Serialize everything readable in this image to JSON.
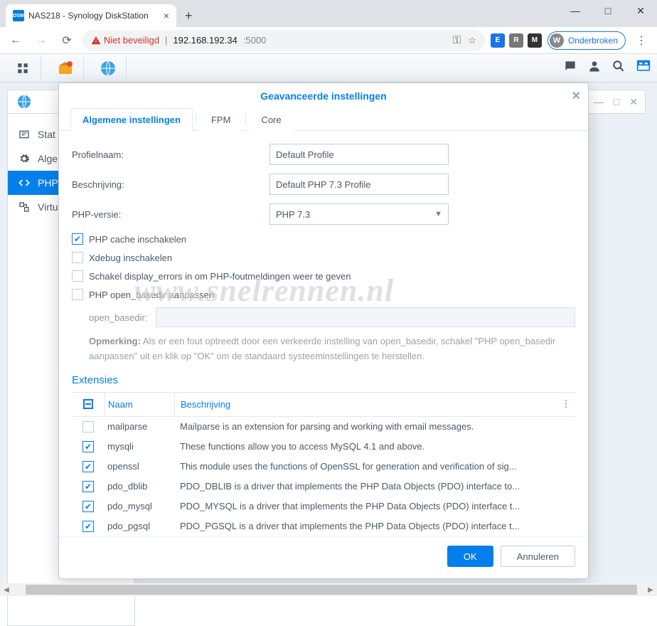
{
  "browser": {
    "tab_title": "NAS218 - Synology DiskStation",
    "tab_favicon_text": "DSM",
    "not_secure": "Niet beveiligd",
    "host": "192.168.192.34",
    "port": ":5000",
    "profile_letter": "W",
    "profile_label": "Onderbroken",
    "ext_badges": [
      "E",
      "R",
      "M"
    ]
  },
  "sidebar": {
    "items": [
      {
        "label": "Stat"
      },
      {
        "label": "Alge"
      },
      {
        "label": "PHP"
      },
      {
        "label": "Virtu"
      }
    ]
  },
  "bg_window": {
    "restore_icon": "—",
    "close_icon": "✕",
    "max_icon": "□"
  },
  "modal": {
    "title": "Geavanceerde instellingen",
    "tabs": {
      "general": "Algemene instellingen",
      "fpm": "FPM",
      "core": "Core"
    },
    "form": {
      "profile_label": "Profielnaam:",
      "profile_value": "Default Profile",
      "desc_label": "Beschrijving:",
      "desc_value": "Default PHP 7.3 Profile",
      "phpver_label": "PHP-versie:",
      "phpver_value": "PHP 7.3",
      "check_cache": "PHP cache inschakelen",
      "check_xdebug": "Xdebug inschakelen",
      "check_display_errors": "Schakel display_errors in om PHP-foutmeldingen weer te geven",
      "check_open_basedir": "PHP open_basedir aanpassen",
      "open_basedir_label": "open_basedir:",
      "note_label": "Opmerking:",
      "note_text": "Als er een fout optreedt door een verkeerde instelling van open_basedir, schakel \"PHP open_basedir aanpassen\" uit en klik op \"OK\" om de standaard systeeminstellingen te herstellen."
    },
    "extensions": {
      "heading": "Extensies",
      "col_name": "Naam",
      "col_desc": "Beschrijving",
      "rows": [
        {
          "checked": false,
          "name": "mailparse",
          "desc": "Mailparse is an extension for parsing and working with email messages."
        },
        {
          "checked": true,
          "name": "mysqli",
          "desc": "These functions allow you to access MySQL 4.1 and above."
        },
        {
          "checked": true,
          "name": "openssl",
          "desc": "This module uses the functions of OpenSSL for generation and verification of sig..."
        },
        {
          "checked": true,
          "name": "pdo_dblib",
          "desc": "PDO_DBLIB is a driver that implements the PHP Data Objects (PDO) interface to..."
        },
        {
          "checked": true,
          "name": "pdo_mysql",
          "desc": "PDO_MYSQL is a driver that implements the PHP Data Objects (PDO) interface t..."
        },
        {
          "checked": true,
          "name": "pdo_pgsql",
          "desc": "PDO_PGSQL is a driver that implements the PHP Data Objects (PDO) interface t..."
        }
      ]
    },
    "footer": {
      "ok": "OK",
      "cancel": "Annuleren"
    }
  },
  "watermark": "www.snelrennen.nl"
}
